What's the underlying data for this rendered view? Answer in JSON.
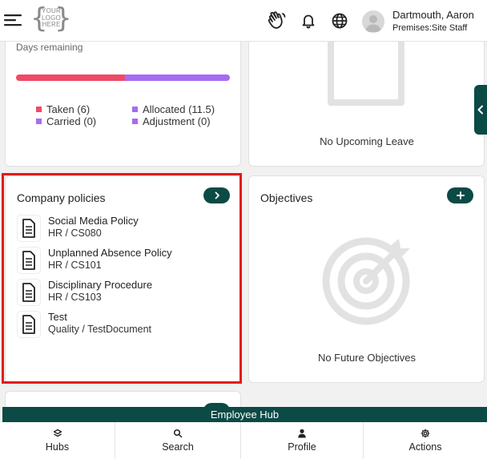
{
  "header": {
    "logo_lines": [
      "YOUR",
      "LOGO",
      "HERE"
    ],
    "user_name": "Dartmouth, Aaron",
    "user_role": "Premises:Site Staff"
  },
  "leave": {
    "days_remaining_label": "Days remaining",
    "taken_fraction": 0.51,
    "legend": {
      "taken": "Taken (6)",
      "allocated": "Allocated (11.5)",
      "carried": "Carried (0)",
      "adjustment": "Adjustment (0)"
    },
    "colors": {
      "taken": "#ef4a67",
      "allocated": "#a66cf2",
      "carried": "#a66cf2",
      "adjustment": "#a66cf2"
    }
  },
  "upcoming": {
    "empty_text": "No Upcoming Leave"
  },
  "policies": {
    "title": "Company policies",
    "items": [
      {
        "title": "Social Media Policy",
        "subtitle": "HR / CS080"
      },
      {
        "title": "Unplanned Absence Policy",
        "subtitle": "HR / CS101"
      },
      {
        "title": "Disciplinary Procedure",
        "subtitle": "HR / CS103"
      },
      {
        "title": "Test",
        "subtitle": "Quality / TestDocument"
      }
    ]
  },
  "objectives": {
    "title": "Objectives",
    "empty_text": "No Future Objectives"
  },
  "footer": {
    "band_label": "Employee Hub",
    "nav": [
      {
        "label": "Hubs",
        "icon": "layers-icon"
      },
      {
        "label": "Search",
        "icon": "search-icon"
      },
      {
        "label": "Profile",
        "icon": "person-icon"
      },
      {
        "label": "Actions",
        "icon": "gear-icon"
      }
    ]
  },
  "theme": {
    "accent": "#0b4a45",
    "highlight": "#e21b1b"
  }
}
